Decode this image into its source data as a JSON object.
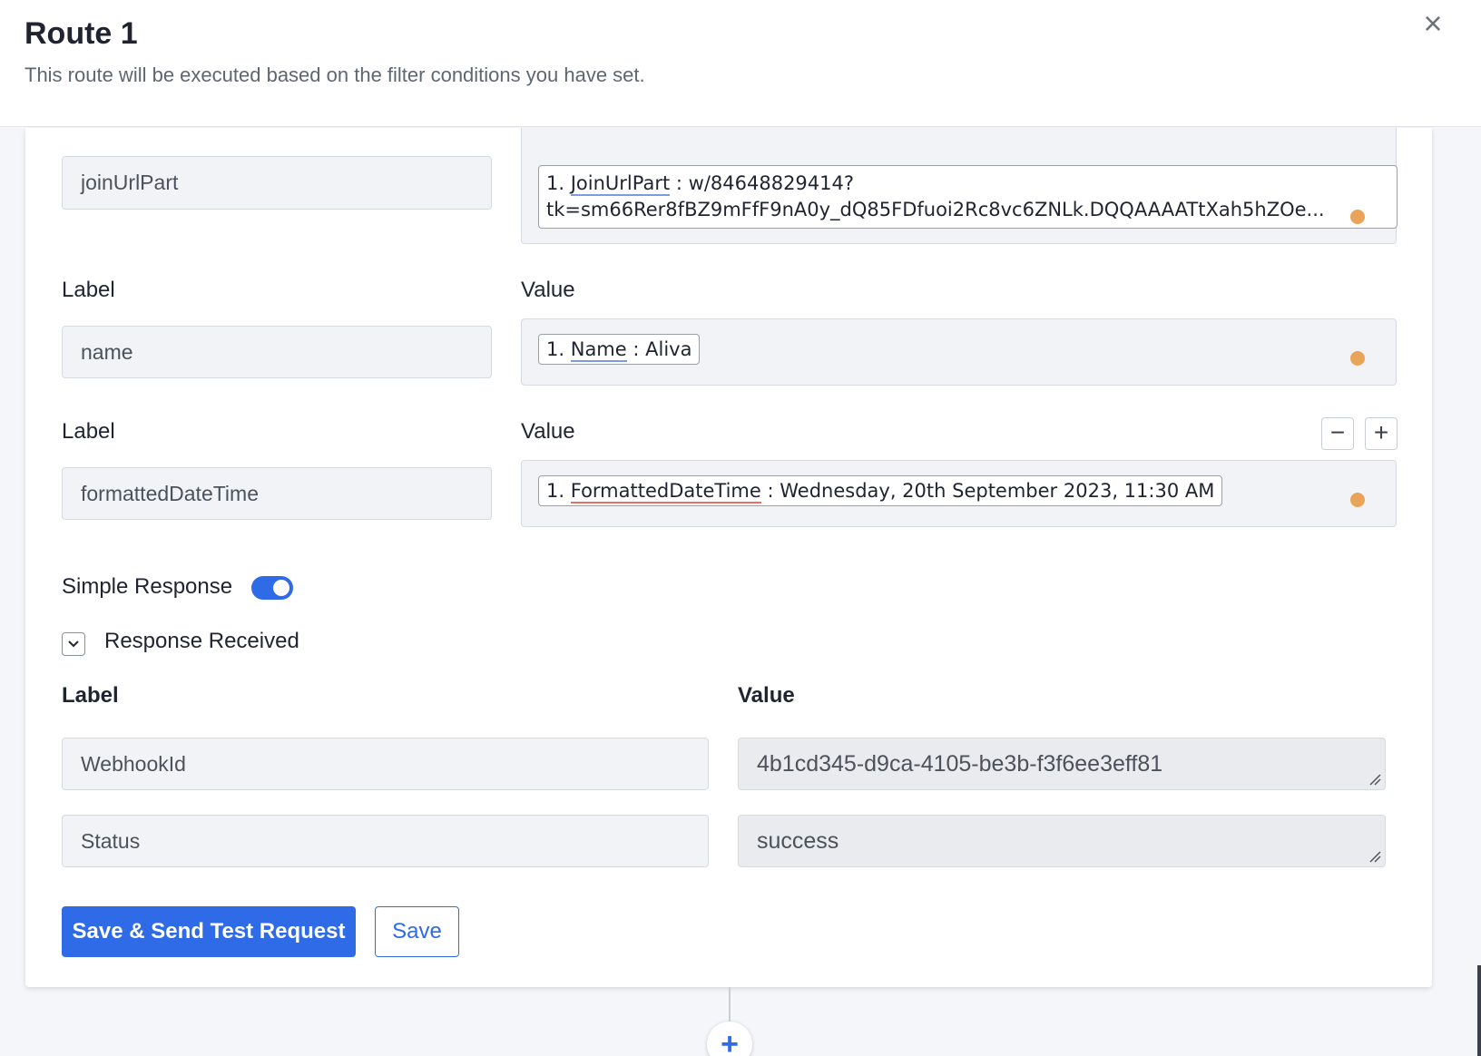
{
  "header": {
    "title": "Route 1",
    "subtitle": "This route will be executed based on the filter conditions you have set.",
    "close_icon": "×"
  },
  "rows": [
    {
      "label_heading": "",
      "value_heading": "",
      "label_value": "joinUrlPart",
      "pill_index": "1.",
      "pill_key": "JoinUrlPart",
      "pill_sep": " : ",
      "pill_value_line1": "w/84648829414?",
      "pill_value_line2": "tk=sm66Rer8fBZ9mFfF9nA0y_dQ85FDfuoi2Rc8vc6ZNLk.DQQAAAATtXah5hZOe..."
    },
    {
      "label_heading": "Label",
      "value_heading": "Value",
      "label_value": "name",
      "pill_index": "1.",
      "pill_key": "Name",
      "pill_sep": " : ",
      "pill_value": "Aliva"
    },
    {
      "label_heading": "Label",
      "value_heading": "Value",
      "label_value": "formattedDateTime",
      "pill_index": "1.",
      "pill_key": "FormattedDateTime",
      "pill_sep": " : ",
      "pill_value": "Wednesday, 20th September 2023, 11:30 AM"
    }
  ],
  "row_controls": {
    "minus": "−",
    "plus": "+"
  },
  "simple_response": {
    "label": "Simple Response",
    "enabled": true
  },
  "response_received": {
    "title": "Response Received",
    "label_heading": "Label",
    "value_heading": "Value",
    "items": [
      {
        "label": "WebhookId",
        "value": "4b1cd345-d9ca-4105-be3b-f3f6ee3eff81"
      },
      {
        "label": "Status",
        "value": "success"
      }
    ]
  },
  "buttons": {
    "save_and_send": "Save & Send Test Request",
    "save": "Save"
  },
  "add_step": "+",
  "colors": {
    "primary": "#2f6be6",
    "dot": "#eaa45a",
    "field_bg": "#f1f3f6"
  }
}
